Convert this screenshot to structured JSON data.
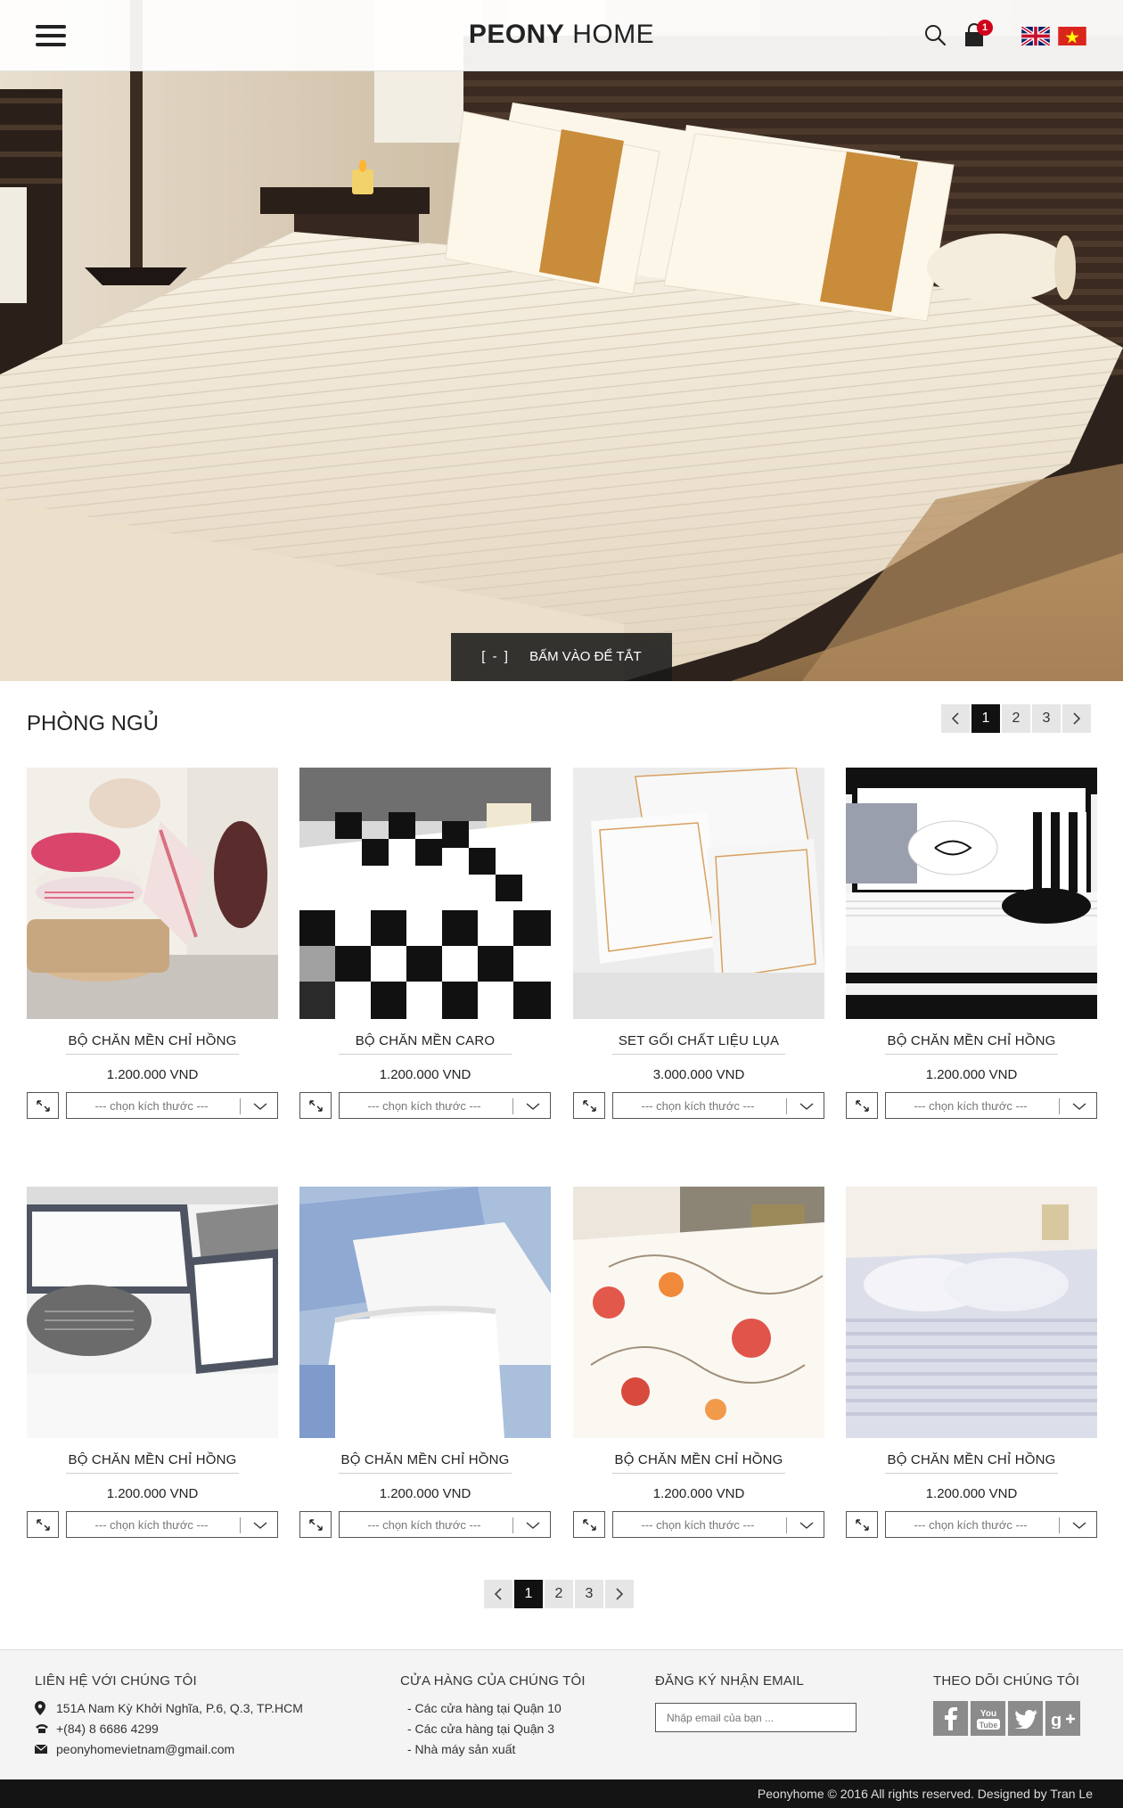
{
  "header": {
    "logo_bold": "PEONY",
    "logo_light": "HOME",
    "cart_count": "1"
  },
  "hero": {
    "toggle_bracket": "[ - ]",
    "toggle_label": "BẤM VÀO ĐỂ TẮT"
  },
  "section": {
    "title": "PHÒNG NGỦ"
  },
  "pagination": {
    "pages": [
      "1",
      "2",
      "3"
    ],
    "active": "1"
  },
  "products": [
    {
      "name": "BỘ CHĂN MỀN CHỈ HỒNG",
      "price": "1.200.000 VND",
      "size_placeholder": "--- chọn kích thước ---",
      "image": "pink-striped-pillows"
    },
    {
      "name": "BỘ CHĂN MỀN CARO",
      "price": "1.200.000 VND",
      "size_placeholder": "--- chọn kích thước ---",
      "image": "black-white-checkered-bedding"
    },
    {
      "name": "SET GỐI CHẤT LIỆU LỤA",
      "price": "3.000.000 VND",
      "size_placeholder": "--- chọn kích thước ---",
      "image": "white-silk-pillows-gold-trim"
    },
    {
      "name": "BỘ CHĂN MỀN CHỈ HỒNG",
      "price": "1.200.000 VND",
      "size_placeholder": "--- chọn kích thước ---",
      "image": "black-white-striped-bedding"
    },
    {
      "name": "BỘ CHĂN MỀN CHỈ HỒNG",
      "price": "1.200.000 VND",
      "size_placeholder": "--- chọn kích thước ---",
      "image": "grey-trim-white-bedding"
    },
    {
      "name": "BỘ CHĂN MỀN CHỈ HỒNG",
      "price": "1.200.000 VND",
      "size_placeholder": "--- chọn kích thước ---",
      "image": "blue-lace-pillows"
    },
    {
      "name": "BỘ CHĂN MỀN CHỈ HỒNG",
      "price": "1.200.000 VND",
      "size_placeholder": "--- chọn kích thước ---",
      "image": "floral-red-bedding"
    },
    {
      "name": "BỘ CHĂN MỀN CHỈ HỒNG",
      "price": "1.200.000 VND",
      "size_placeholder": "--- chọn kích thước ---",
      "image": "white-striped-hotel-bedding"
    }
  ],
  "footer": {
    "contact": {
      "title": "LIÊN HỆ VỚI CHÚNG TÔI",
      "address": "151A Nam Kỳ Khởi Nghĩa, P.6, Q.3, TP.HCM",
      "phone": "+(84) 8 6686 4299",
      "email": "peonyhomevietnam@gmail.com"
    },
    "stores": {
      "title": "CỬA HÀNG CỦA CHÚNG TÔI",
      "items": [
        "- Các cửa hàng tại Quận 10",
        "- Các cửa hàng tại Quận 3",
        "- Nhà máy sản xuất"
      ]
    },
    "newsletter": {
      "title": "ĐĂNG KÝ NHẬN EMAIL",
      "placeholder": "Nhập email của bạn ..."
    },
    "social": {
      "title": "THEO DÕI CHÚNG TÔI",
      "networks": [
        "facebook-icon",
        "youtube-icon",
        "twitter-icon",
        "google-plus-icon"
      ]
    },
    "copyright": "Peonyhome © 2016 All rights reserved. Designed by Tran Le"
  },
  "colors": {
    "accent_dark": "#111111",
    "badge_red": "#d0021b",
    "footer_bg": "#f4f4f4",
    "social_grey": "#8b8b8b"
  }
}
